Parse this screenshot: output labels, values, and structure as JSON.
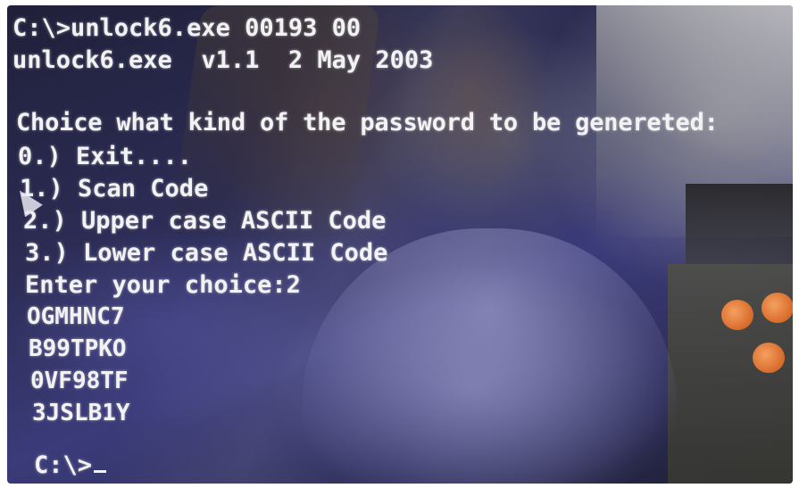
{
  "terminal": {
    "command_line": "C:\\>unlock6.exe 00193 00",
    "version_line": "unlock6.exe  v1.1  2 May 2003",
    "question": "Choice what kind of the password to be genereted:",
    "options": [
      "0.) Exit....",
      "1.) Scan Code",
      "2.) Upper case ASCII Code",
      "3.) Lower case ASCII Code"
    ],
    "choice_line": "Enter your choice:2",
    "codes": [
      "OGMHNC7",
      "B99TPKO",
      "0VF98TF",
      "3JSLB1Y"
    ],
    "final_prompt": "C:\\>"
  },
  "colors": {
    "text": "#f2f2f2",
    "screen_base": "#2c2c55"
  },
  "icons": {
    "pointer": "mouse-pointer-icon",
    "cursor": "text-cursor-icon"
  }
}
